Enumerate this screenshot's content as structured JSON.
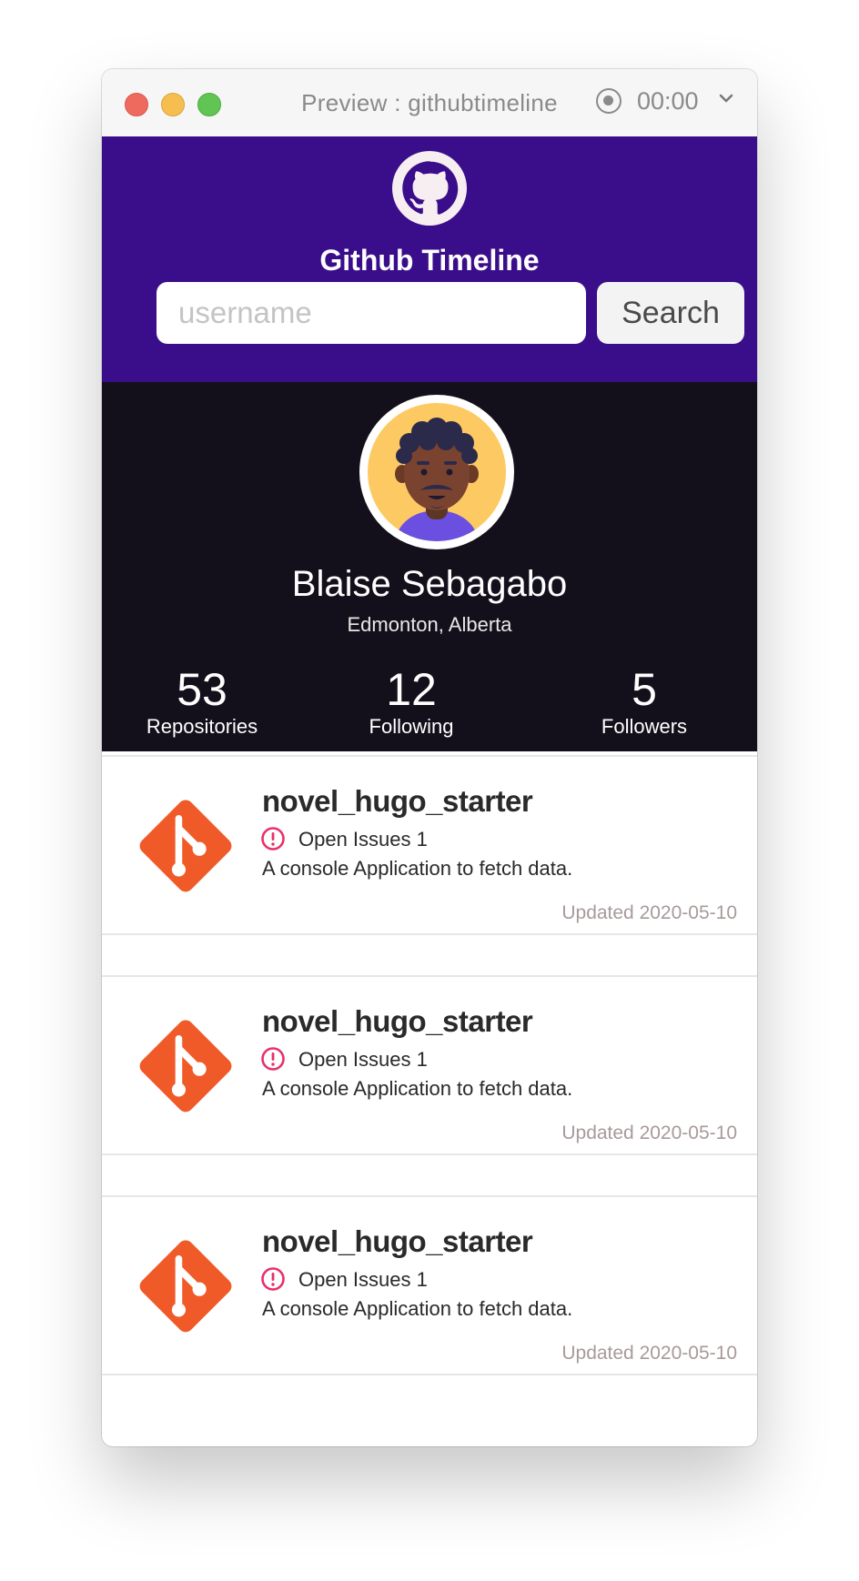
{
  "window": {
    "title": "Preview : githubtimeline",
    "timer": "00:00"
  },
  "header": {
    "app_title": "Github Timeline",
    "search_placeholder": "username",
    "search_value": "",
    "search_button": "Search",
    "color": "#3a0e8a"
  },
  "profile": {
    "name": "Blaise Sebagabo",
    "location": "Edmonton, Alberta",
    "stats": [
      {
        "value": "53",
        "label": "Repositories"
      },
      {
        "value": "12",
        "label": "Following"
      },
      {
        "value": "5",
        "label": "Followers"
      }
    ]
  },
  "repos": [
    {
      "name": "novel_hugo_starter",
      "issues": "Open Issues 1",
      "description": "A console Application to fetch data.",
      "updated": "Updated 2020-05-10"
    },
    {
      "name": "novel_hugo_starter",
      "issues": "Open Issues 1",
      "description": "A console Application to fetch data.",
      "updated": "Updated 2020-05-10"
    },
    {
      "name": "novel_hugo_starter",
      "issues": "Open Issues 1",
      "description": "A console Application to fetch data.",
      "updated": "Updated 2020-05-10"
    }
  ],
  "colors": {
    "git_orange": "#f05a28",
    "issue_pink": "#e8306a",
    "profile_bg": "#13101b"
  }
}
